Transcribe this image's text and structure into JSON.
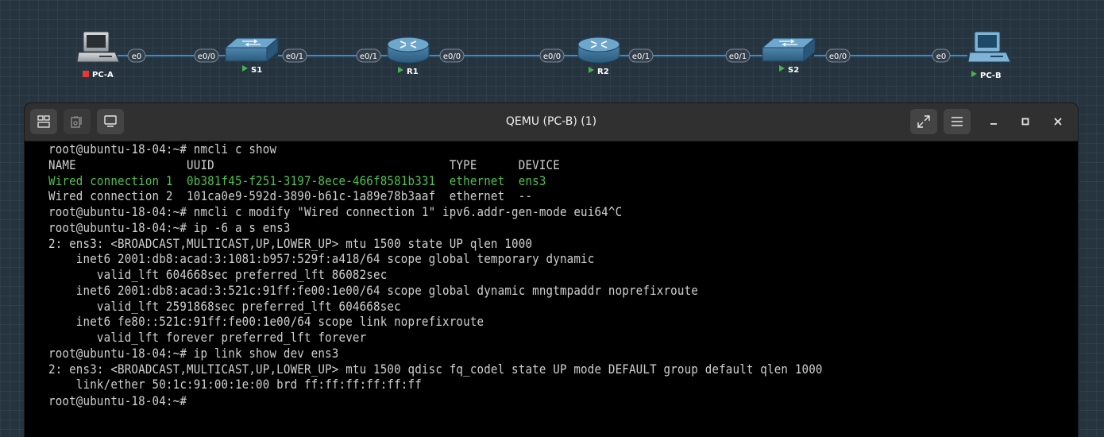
{
  "topology": {
    "devices": [
      {
        "id": "pc-a",
        "label": "PC-A",
        "kind": "pc",
        "status": "stopped",
        "status_color": "#e53935"
      },
      {
        "id": "s1",
        "label": "S1",
        "kind": "switch",
        "status": "running",
        "status_color": "#4caf50"
      },
      {
        "id": "r1",
        "label": "R1",
        "kind": "router",
        "status": "running",
        "status_color": "#4caf50"
      },
      {
        "id": "r2",
        "label": "R2",
        "kind": "router",
        "status": "running",
        "status_color": "#4caf50"
      },
      {
        "id": "s2",
        "label": "S2",
        "kind": "switch",
        "status": "running",
        "status_color": "#4caf50"
      },
      {
        "id": "pc-b",
        "label": "PC-B",
        "kind": "pc",
        "status": "running",
        "status_color": "#4caf50"
      }
    ],
    "links": [
      {
        "a": "pc-a",
        "a_port": "e0",
        "b": "s1",
        "b_port": "e0/0"
      },
      {
        "a": "s1",
        "a_port": "e0/1",
        "b": "r1",
        "b_port": "e0/1"
      },
      {
        "a": "r1",
        "a_port": "e0/0",
        "b": "r2",
        "b_port": "e0/0"
      },
      {
        "a": "r2",
        "a_port": "e0/1",
        "b": "s2",
        "b_port": "e0/1"
      },
      {
        "a": "s2",
        "a_port": "e0/0",
        "b": "pc-b",
        "b_port": "e0"
      }
    ],
    "link_color": "#2f8fd6"
  },
  "window": {
    "title": "QEMU (PC-B) (1)",
    "left_buttons": [
      "layout-icon",
      "media-icon",
      "display-icon"
    ],
    "right_buttons": [
      "fullscreen-icon",
      "menu-icon",
      "minimize-icon",
      "maximize-icon",
      "close-icon"
    ]
  },
  "terminal": {
    "lines": [
      {
        "text": "root@ubuntu-18-04:~# nmcli c show",
        "color": "default"
      },
      {
        "text": "NAME                UUID                                  TYPE      DEVICE",
        "color": "default"
      },
      {
        "text": "Wired connection 1  0b381f45-f251-3197-8ece-466f8581b331  ethernet  ens3",
        "color": "green"
      },
      {
        "text": "Wired connection 2  101ca0e9-592d-3890-b61c-1a89e78b3aaf  ethernet  --",
        "color": "default"
      },
      {
        "text": "root@ubuntu-18-04:~# nmcli c modify \"Wired connection 1\" ipv6.addr-gen-mode eui64^C",
        "color": "default"
      },
      {
        "text": "root@ubuntu-18-04:~# ip -6 a s ens3",
        "color": "default"
      },
      {
        "text": "2: ens3: <BROADCAST,MULTICAST,UP,LOWER_UP> mtu 1500 state UP qlen 1000",
        "color": "default"
      },
      {
        "text": "    inet6 2001:db8:acad:3:1081:b957:529f:a418/64 scope global temporary dynamic",
        "color": "default"
      },
      {
        "text": "       valid_lft 604668sec preferred_lft 86082sec",
        "color": "default"
      },
      {
        "text": "    inet6 2001:db8:acad:3:521c:91ff:fe00:1e00/64 scope global dynamic mngtmpaddr noprefixroute",
        "color": "default"
      },
      {
        "text": "       valid_lft 2591868sec preferred_lft 604668sec",
        "color": "default"
      },
      {
        "text": "    inet6 fe80::521c:91ff:fe00:1e00/64 scope link noprefixroute",
        "color": "default"
      },
      {
        "text": "       valid_lft forever preferred_lft forever",
        "color": "default"
      },
      {
        "text": "root@ubuntu-18-04:~# ip link show dev ens3",
        "color": "default"
      },
      {
        "text": "2: ens3: <BROADCAST,MULTICAST,UP,LOWER_UP> mtu 1500 qdisc fq_codel state UP mode DEFAULT group default qlen 1000",
        "color": "default"
      },
      {
        "text": "    link/ether 50:1c:91:00:1e:00 brd ff:ff:ff:ff:ff:ff",
        "color": "default"
      },
      {
        "text": "root@ubuntu-18-04:~#",
        "color": "default"
      }
    ],
    "colors": {
      "default": "#d0d0d0",
      "green": "#4cc44c"
    }
  }
}
